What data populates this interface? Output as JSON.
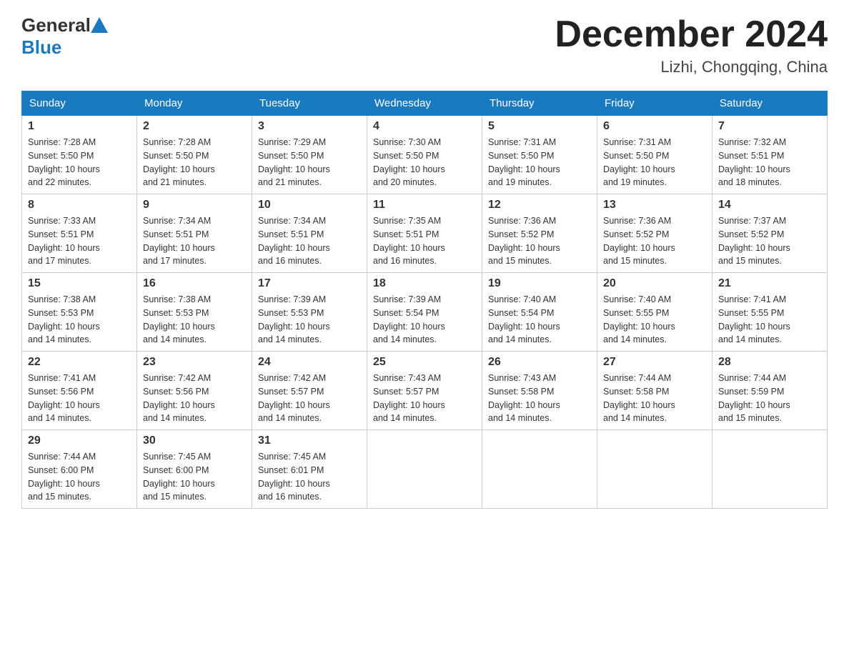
{
  "header": {
    "logo_general": "General",
    "logo_blue": "Blue",
    "month_title": "December 2024",
    "location": "Lizhi, Chongqing, China"
  },
  "days_of_week": [
    "Sunday",
    "Monday",
    "Tuesday",
    "Wednesday",
    "Thursday",
    "Friday",
    "Saturday"
  ],
  "weeks": [
    [
      {
        "day": "1",
        "sunrise": "7:28 AM",
        "sunset": "5:50 PM",
        "daylight": "10 hours and 22 minutes."
      },
      {
        "day": "2",
        "sunrise": "7:28 AM",
        "sunset": "5:50 PM",
        "daylight": "10 hours and 21 minutes."
      },
      {
        "day": "3",
        "sunrise": "7:29 AM",
        "sunset": "5:50 PM",
        "daylight": "10 hours and 21 minutes."
      },
      {
        "day": "4",
        "sunrise": "7:30 AM",
        "sunset": "5:50 PM",
        "daylight": "10 hours and 20 minutes."
      },
      {
        "day": "5",
        "sunrise": "7:31 AM",
        "sunset": "5:50 PM",
        "daylight": "10 hours and 19 minutes."
      },
      {
        "day": "6",
        "sunrise": "7:31 AM",
        "sunset": "5:50 PM",
        "daylight": "10 hours and 19 minutes."
      },
      {
        "day": "7",
        "sunrise": "7:32 AM",
        "sunset": "5:51 PM",
        "daylight": "10 hours and 18 minutes."
      }
    ],
    [
      {
        "day": "8",
        "sunrise": "7:33 AM",
        "sunset": "5:51 PM",
        "daylight": "10 hours and 17 minutes."
      },
      {
        "day": "9",
        "sunrise": "7:34 AM",
        "sunset": "5:51 PM",
        "daylight": "10 hours and 17 minutes."
      },
      {
        "day": "10",
        "sunrise": "7:34 AM",
        "sunset": "5:51 PM",
        "daylight": "10 hours and 16 minutes."
      },
      {
        "day": "11",
        "sunrise": "7:35 AM",
        "sunset": "5:51 PM",
        "daylight": "10 hours and 16 minutes."
      },
      {
        "day": "12",
        "sunrise": "7:36 AM",
        "sunset": "5:52 PM",
        "daylight": "10 hours and 15 minutes."
      },
      {
        "day": "13",
        "sunrise": "7:36 AM",
        "sunset": "5:52 PM",
        "daylight": "10 hours and 15 minutes."
      },
      {
        "day": "14",
        "sunrise": "7:37 AM",
        "sunset": "5:52 PM",
        "daylight": "10 hours and 15 minutes."
      }
    ],
    [
      {
        "day": "15",
        "sunrise": "7:38 AM",
        "sunset": "5:53 PM",
        "daylight": "10 hours and 14 minutes."
      },
      {
        "day": "16",
        "sunrise": "7:38 AM",
        "sunset": "5:53 PM",
        "daylight": "10 hours and 14 minutes."
      },
      {
        "day": "17",
        "sunrise": "7:39 AM",
        "sunset": "5:53 PM",
        "daylight": "10 hours and 14 minutes."
      },
      {
        "day": "18",
        "sunrise": "7:39 AM",
        "sunset": "5:54 PM",
        "daylight": "10 hours and 14 minutes."
      },
      {
        "day": "19",
        "sunrise": "7:40 AM",
        "sunset": "5:54 PM",
        "daylight": "10 hours and 14 minutes."
      },
      {
        "day": "20",
        "sunrise": "7:40 AM",
        "sunset": "5:55 PM",
        "daylight": "10 hours and 14 minutes."
      },
      {
        "day": "21",
        "sunrise": "7:41 AM",
        "sunset": "5:55 PM",
        "daylight": "10 hours and 14 minutes."
      }
    ],
    [
      {
        "day": "22",
        "sunrise": "7:41 AM",
        "sunset": "5:56 PM",
        "daylight": "10 hours and 14 minutes."
      },
      {
        "day": "23",
        "sunrise": "7:42 AM",
        "sunset": "5:56 PM",
        "daylight": "10 hours and 14 minutes."
      },
      {
        "day": "24",
        "sunrise": "7:42 AM",
        "sunset": "5:57 PM",
        "daylight": "10 hours and 14 minutes."
      },
      {
        "day": "25",
        "sunrise": "7:43 AM",
        "sunset": "5:57 PM",
        "daylight": "10 hours and 14 minutes."
      },
      {
        "day": "26",
        "sunrise": "7:43 AM",
        "sunset": "5:58 PM",
        "daylight": "10 hours and 14 minutes."
      },
      {
        "day": "27",
        "sunrise": "7:44 AM",
        "sunset": "5:58 PM",
        "daylight": "10 hours and 14 minutes."
      },
      {
        "day": "28",
        "sunrise": "7:44 AM",
        "sunset": "5:59 PM",
        "daylight": "10 hours and 15 minutes."
      }
    ],
    [
      {
        "day": "29",
        "sunrise": "7:44 AM",
        "sunset": "6:00 PM",
        "daylight": "10 hours and 15 minutes."
      },
      {
        "day": "30",
        "sunrise": "7:45 AM",
        "sunset": "6:00 PM",
        "daylight": "10 hours and 15 minutes."
      },
      {
        "day": "31",
        "sunrise": "7:45 AM",
        "sunset": "6:01 PM",
        "daylight": "10 hours and 16 minutes."
      },
      null,
      null,
      null,
      null
    ]
  ],
  "labels": {
    "sunrise": "Sunrise:",
    "sunset": "Sunset:",
    "daylight": "Daylight:"
  }
}
